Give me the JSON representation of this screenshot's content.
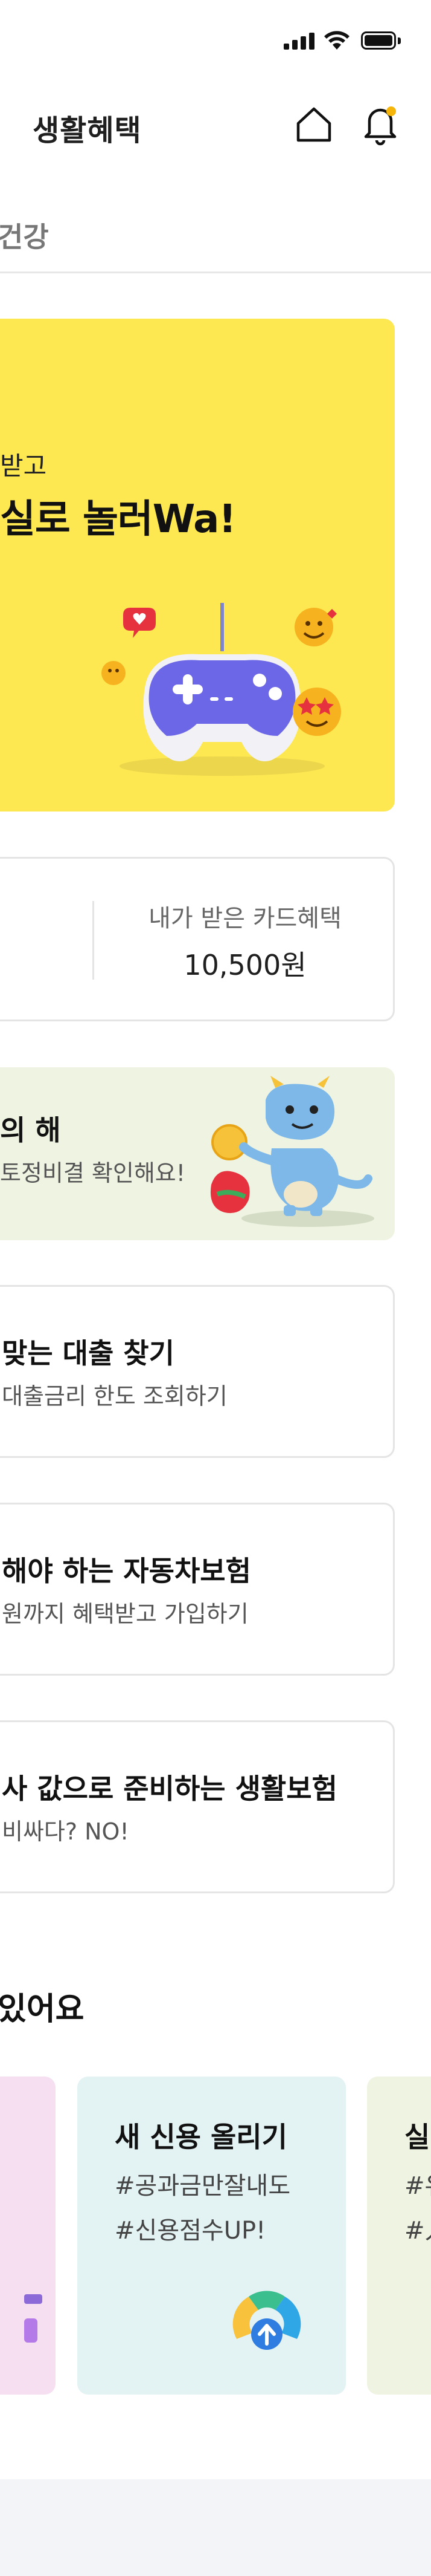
{
  "header": {
    "title": "생활혜택"
  },
  "tab": {
    "label": "건강"
  },
  "banner": {
    "subtitle": "받고",
    "title": "실로 놀러Wa!"
  },
  "card_benefit": {
    "label": "내가 받은 카드혜택",
    "value": "10,500원"
  },
  "zodiac": {
    "title": "의 해",
    "subtitle": "토정비결 확인해요!"
  },
  "loan": {
    "title": "맞는 대출 찾기",
    "subtitle": "대출금리 한도 조회하기"
  },
  "car_insurance": {
    "title": "해야 하는 자동차보험",
    "subtitle": "원까지 혜택받고 가입하기"
  },
  "life_insurance": {
    "title": "사 값으로 준비하는 생활보험",
    "subtitle": "비싸다? NO!"
  },
  "section": {
    "title": "있어요"
  },
  "tiles": [
    {
      "title": "",
      "line1": "",
      "line2": "",
      "bg": "#f5dff0"
    },
    {
      "title": "새 신용 올리기",
      "line1": "#공과금만잘내도",
      "line2": "#신용점수UP!",
      "bg": "#e3f2f3"
    },
    {
      "title": "실",
      "line1": "#유",
      "line2": "#人",
      "bg": "#eef3e2"
    }
  ],
  "colors": {
    "banner_bg": "#fee851",
    "notification_dot": "#f5b50a",
    "card_border": "#e4e4e4"
  }
}
